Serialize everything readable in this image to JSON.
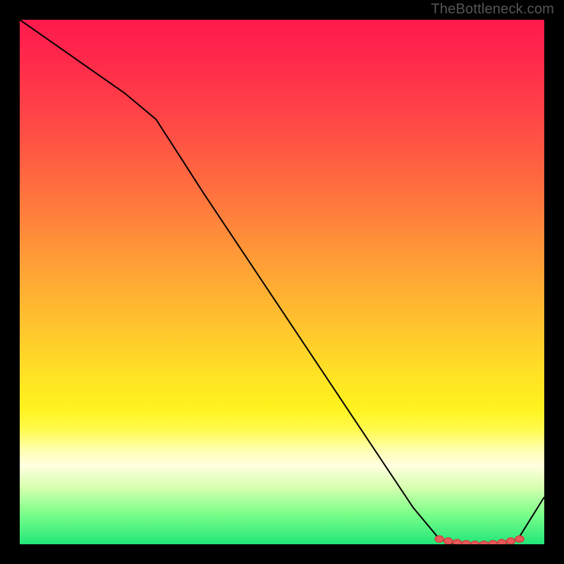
{
  "attribution": "TheBottleneck.com",
  "chart_data": {
    "type": "line",
    "title": "",
    "xlabel": "",
    "ylabel": "",
    "xlim": [
      0,
      100
    ],
    "ylim": [
      0,
      100
    ],
    "background_gradient": {
      "top": "#ff1a4d",
      "mid": "#ffe324",
      "bottom": "#22e67a"
    },
    "series": [
      {
        "name": "bottleneck-curve",
        "x": [
          0,
          10,
          20,
          26,
          35,
          45,
          55,
          65,
          75,
          80,
          83,
          86,
          89,
          92,
          95,
          100
        ],
        "y": [
          100,
          93,
          86,
          81,
          67,
          52,
          37,
          22,
          7,
          1,
          0,
          0,
          0,
          0,
          1,
          9
        ]
      }
    ],
    "optimal_markers": {
      "name": "optimal-range",
      "x": [
        80,
        81.7,
        83.4,
        85.1,
        86.8,
        88.5,
        90.2,
        91.9,
        93.6,
        95.3
      ],
      "y": [
        1,
        0.6,
        0.3,
        0.1,
        0,
        0,
        0.1,
        0.3,
        0.6,
        1
      ]
    }
  }
}
